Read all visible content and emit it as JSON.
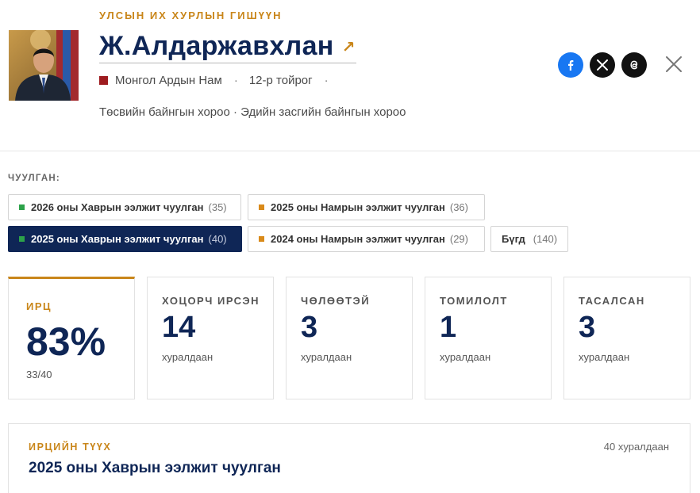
{
  "header": {
    "role": "УЛСЫН ИХ ХУРЛЫН ГИШҮҮН",
    "name": "Ж.Алдаржавхлан",
    "external_link_icon": "↗",
    "party": "Монгол Ардын Нам",
    "party_color": "#9e1c20",
    "separator": "·",
    "district": "12-р тойрог",
    "committees": "Төсвийн байнгын хороо · Эдийн засгийн байнгын хороо",
    "social": [
      {
        "icon": "facebook-icon",
        "glyph": "f",
        "color": "#1877f2"
      },
      {
        "icon": "x-icon",
        "glyph": "X",
        "color": "#111111"
      },
      {
        "icon": "threads-icon",
        "glyph": "@",
        "color": "#111111"
      }
    ]
  },
  "sessions": {
    "label": "ЧУУЛГАН:",
    "items": [
      {
        "label": "2026 оны Хаврын ээлжит чуулган",
        "count": "(35)",
        "color": "#2ca24a",
        "active": false
      },
      {
        "label": "2025 оны Намрын ээлжит чуулган",
        "count": "(36)",
        "color": "#d98a1a",
        "active": false
      },
      {
        "label": "2025 оны Хаврын ээлжит чуулган",
        "count": "(40)",
        "color": "#2ca24a",
        "active": true
      },
      {
        "label": "2024 оны Намрын ээлжит чуулган",
        "count": "(29)",
        "color": "#d98a1a",
        "active": false
      },
      {
        "label": "Бүгд",
        "count": "(140)",
        "color": "",
        "active": false
      }
    ]
  },
  "stats": [
    {
      "label": "ИРЦ",
      "value": "83%",
      "sub": "33/40",
      "primary": true
    },
    {
      "label": "ХОЦОРЧ ИРСЭН",
      "value": "14",
      "sub": "хуралдаан"
    },
    {
      "label": "ЧӨЛӨӨТЭЙ",
      "value": "3",
      "sub": "хуралдаан"
    },
    {
      "label": "ТОМИЛОЛТ",
      "value": "1",
      "sub": "хуралдаан"
    },
    {
      "label": "ТАСАЛСАН",
      "value": "3",
      "sub": "хуралдаан"
    }
  ],
  "history": {
    "label": "ИРЦИЙН ТҮҮХ",
    "count": "40 хуралдаан",
    "title": "2025 оны Хаврын ээлжит чуулган"
  },
  "colors": {
    "accent": "#c9861a",
    "navy": "#0f2656"
  }
}
